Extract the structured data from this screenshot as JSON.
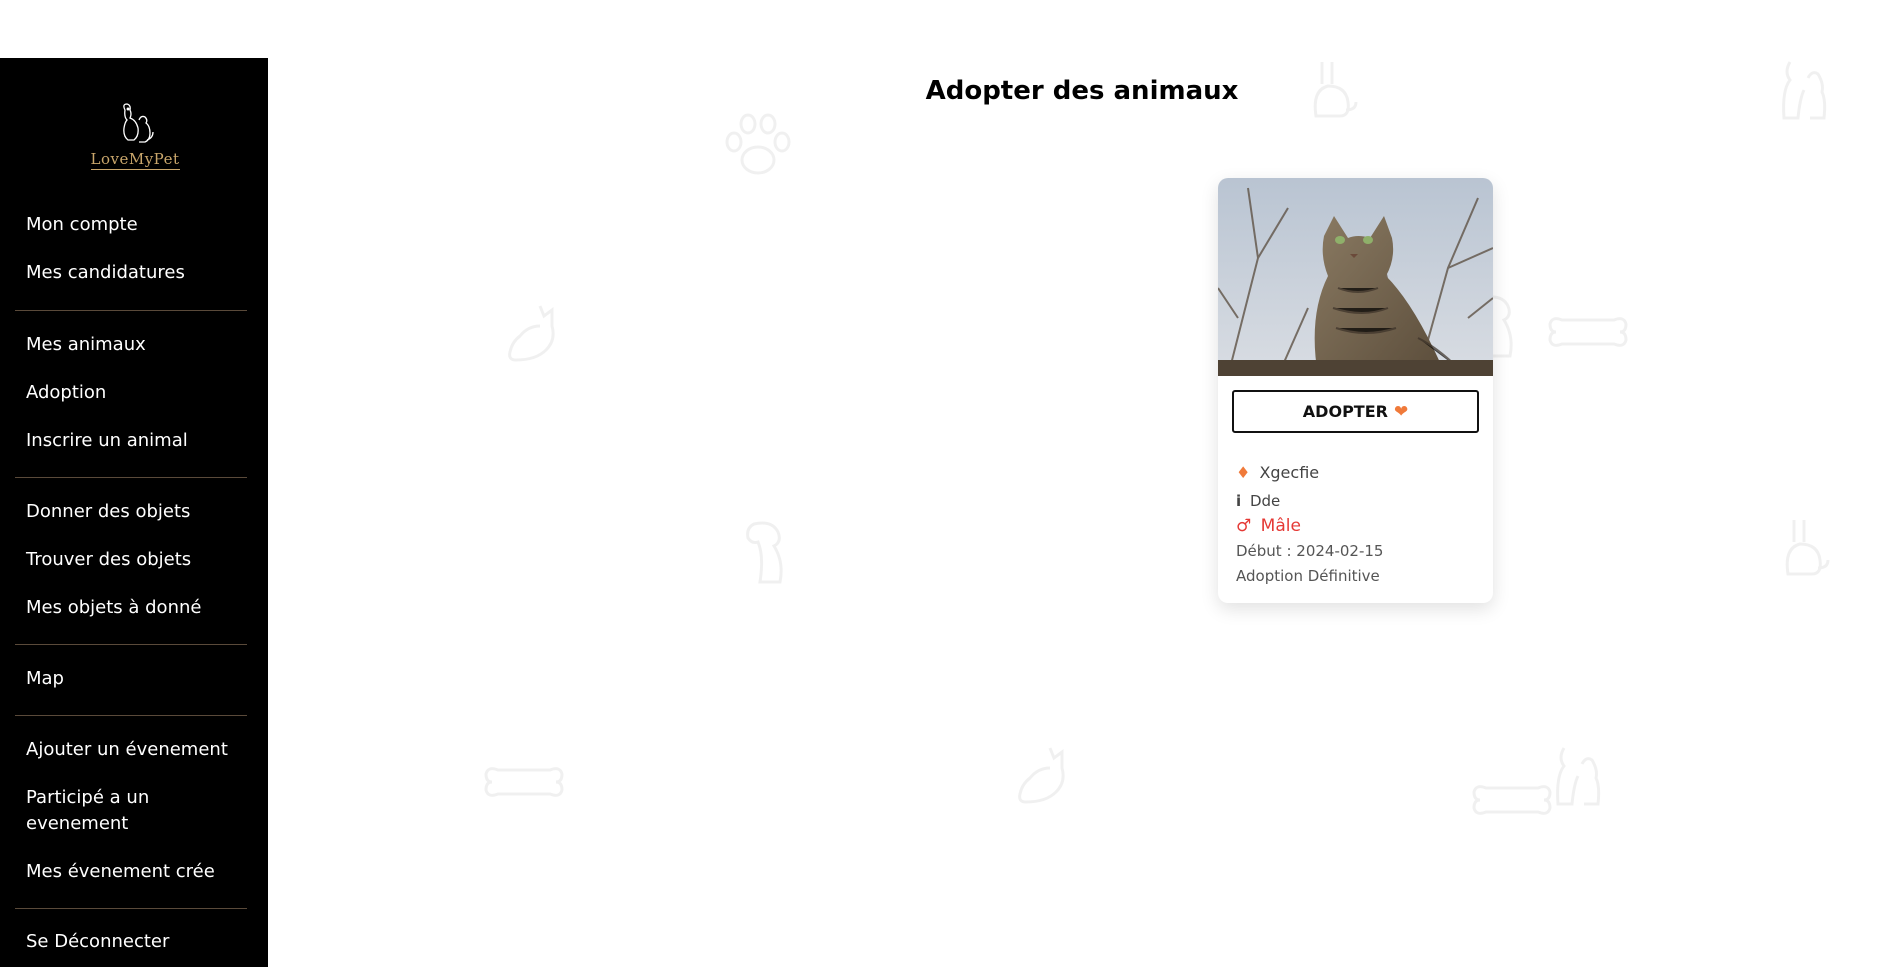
{
  "brand": {
    "name": "LoveMyPet"
  },
  "sidebar": {
    "items": [
      {
        "label": "Mon compte"
      },
      {
        "label": "Mes candidatures"
      },
      {
        "label": "Mes animaux"
      },
      {
        "label": "Adoption"
      },
      {
        "label": "Inscrire un animal"
      },
      {
        "label": "Donner des objets"
      },
      {
        "label": "Trouver des objets"
      },
      {
        "label": "Mes objets à donné"
      },
      {
        "label": "Map"
      },
      {
        "label": "Ajouter un évenement"
      },
      {
        "label": "Participé a un evenement"
      },
      {
        "label": "Mes évenement crée"
      },
      {
        "label": "Se Déconnecter"
      }
    ]
  },
  "main": {
    "title": "Adopter des animaux",
    "card": {
      "photo_icon": "cat-photo",
      "adopt_label": "ADOPTER",
      "adopt_icon": "heart-icon",
      "name": "Xgecfie",
      "name_icon": "fire-icon",
      "description": "Dde",
      "description_icon": "info-icon",
      "gender": "Mâle",
      "gender_icon": "male-symbol-icon",
      "start_date": "Début : 2024-02-15",
      "adoption_type": "Adoption Définitive"
    }
  },
  "colors": {
    "sidebar_bg": "#000000",
    "accent_red": "#e53935",
    "heart_orange": "#f07a3a",
    "logo_gold": "#c9a66b"
  }
}
